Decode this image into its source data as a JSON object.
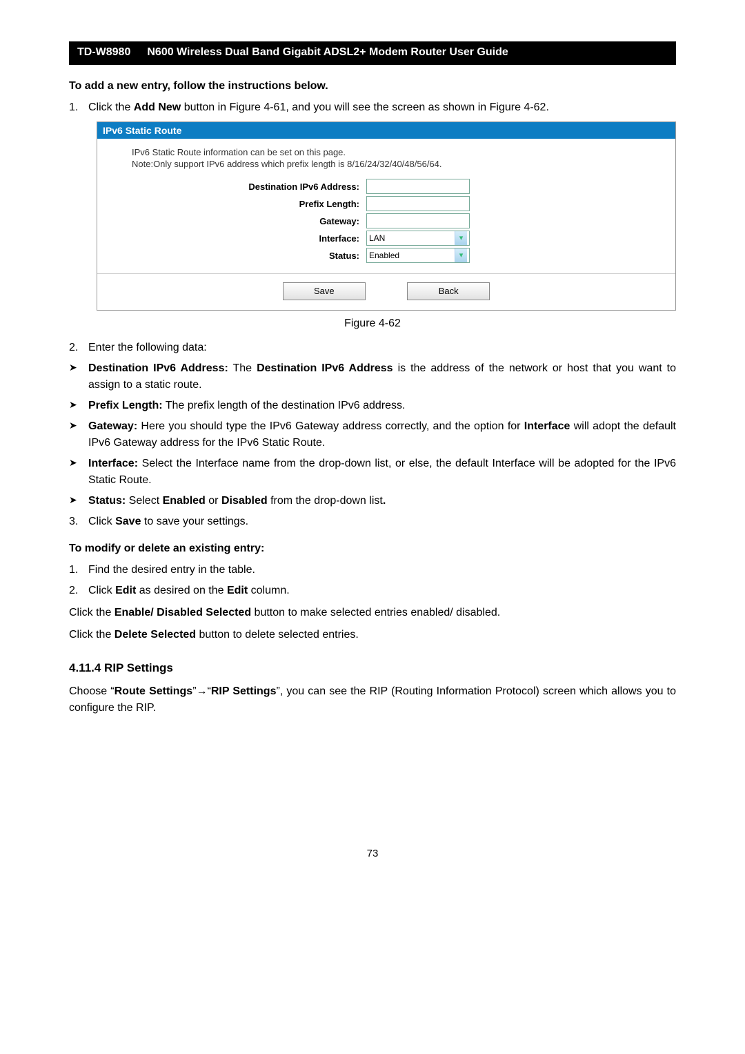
{
  "header": {
    "model": "TD-W8980",
    "title": "N600 Wireless Dual Band Gigabit ADSL2+ Modem Router User Guide"
  },
  "section_add_title": "To add a new entry, follow the instructions below.",
  "step1_num": "1.",
  "step1_prefix": "Click the ",
  "step1_bold1": "Add New",
  "step1_mid": " button in Figure 4-61, and you will see the screen as shown in Figure 4-62.",
  "figure": {
    "header": "IPv6 Static Route",
    "info1": "IPv6 Static Route information can be set on this page.",
    "info2": "Note:Only support IPv6 address which prefix length is 8/16/24/32/40/48/56/64.",
    "labels": {
      "dest": "Destination IPv6 Address:",
      "plen": "Prefix Length:",
      "gw": "Gateway:",
      "iface": "Interface:",
      "status": "Status:"
    },
    "values": {
      "iface": "LAN",
      "status": "Enabled"
    },
    "buttons": {
      "save": "Save",
      "back": "Back"
    }
  },
  "caption": "Figure 4-62",
  "step2_num": "2.",
  "step2_text": "Enter the following data:",
  "bullets": {
    "mark": "➤",
    "b1_t1": "Destination IPv6 Address:",
    "b1_t2": " The ",
    "b1_t3": "Destination IPv6 Address",
    "b1_t4": " is the address of the network or host that you want to assign to a static route.",
    "b2_t1": "Prefix Length:",
    "b2_t2": " The prefix length of the destination IPv6 address.",
    "b3_t1": "Gateway:",
    "b3_t2": " Here you should type the IPv6 Gateway address correctly, and the option for ",
    "b3_t3": "Interface",
    "b3_t4": " will adopt the default IPv6 Gateway address for the IPv6 Static Route.",
    "b4_t1": "Interface:",
    "b4_t2": " Select the Interface name from the drop-down list, or else, the default Interface will be adopted for the IPv6 Static Route.",
    "b5_t1": "Status:",
    "b5_t2": " Select ",
    "b5_t3": "Enabled",
    "b5_t4": " or ",
    "b5_t5": "Disabled",
    "b5_t6": " from the drop-down list",
    "b5_t7": "."
  },
  "step3_num": "3.",
  "step3_t1": "Click ",
  "step3_t2": "Save",
  "step3_t3": " to save your settings.",
  "section_mod_title": "To modify or delete an existing entry:",
  "m1_num": "1.",
  "m1_text": "Find the desired entry in the table.",
  "m2_num": "2.",
  "m2_t1": "Click ",
  "m2_t2": "Edit",
  "m2_t3": " as desired on the ",
  "m2_t4": "Edit",
  "m2_t5": " column.",
  "enable_p1": "Click the ",
  "enable_p2": "Enable/ Disabled Selected",
  "enable_p3": " button to make selected entries enabled/ disabled.",
  "delete_p1": "Click the ",
  "delete_p2": "Delete Selected",
  "delete_p3": " button to delete selected entries.",
  "subsection": "4.11.4 RIP Settings",
  "rip_p1": "Choose “",
  "rip_p2": "Route Settings",
  "rip_p3": "”",
  "rip_arrow": "→",
  "rip_p4": "“",
  "rip_p5": "RIP Settings",
  "rip_p6": "”, you can see the RIP (Routing Information Protocol) screen which allows you to configure the RIP.",
  "pagenum": "73"
}
